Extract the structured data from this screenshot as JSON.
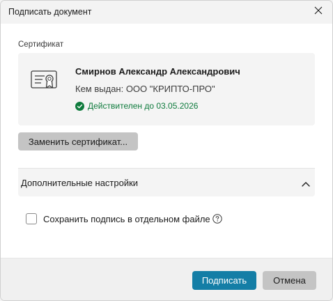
{
  "window": {
    "title": "Подписать документ",
    "close_icon": "close-icon"
  },
  "certificate": {
    "section_label": "Сертификат",
    "icon": "certificate-icon",
    "owner_name": "Смирнов Александр Александрович",
    "issuer": "Кем выдан: ООО \"КРИПТО-ПРО\"",
    "status_icon": "check-circle-icon",
    "status_text": "Действителен до 03.05.2026",
    "status_color": "#0f7b3d",
    "replace_button_label": "Заменить сертификат..."
  },
  "advanced": {
    "header_label": "Дополнительные настройки",
    "expanded": true,
    "chevron_icon": "chevron-up-icon",
    "save_separate_label": "Сохранить подпись в отдельном файле",
    "save_separate_checked": false,
    "help_icon": "help-icon"
  },
  "footer": {
    "sign_label": "Подписать",
    "cancel_label": "Отмена",
    "accent_color": "#147ea6"
  }
}
